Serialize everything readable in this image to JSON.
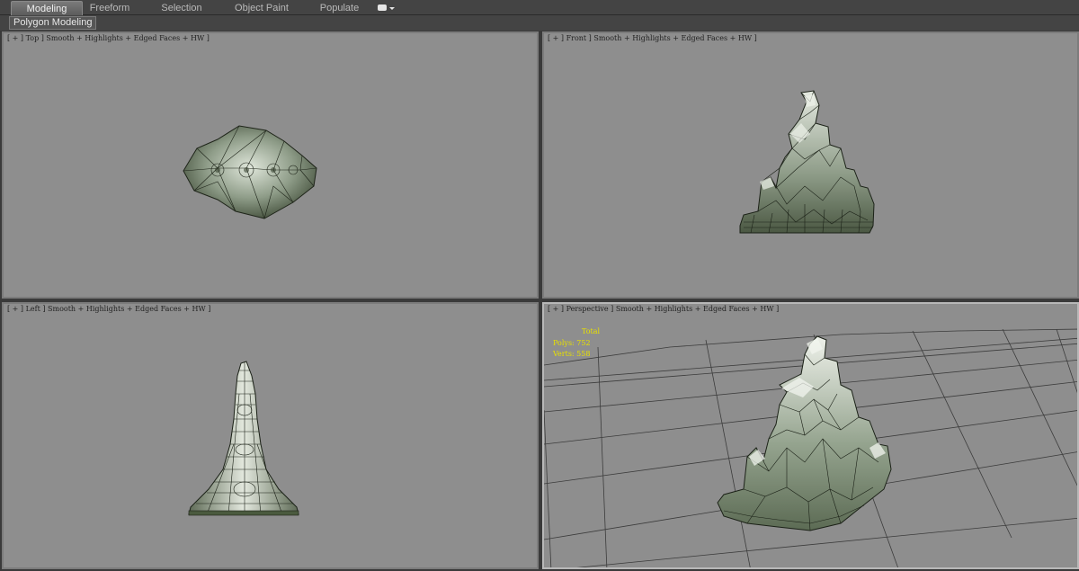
{
  "ribbon": {
    "tabs": [
      {
        "label": "Modeling",
        "active": true
      },
      {
        "label": "Freeform",
        "active": false
      },
      {
        "label": "Selection",
        "active": false
      },
      {
        "label": "Object Paint",
        "active": false
      },
      {
        "label": "Populate",
        "active": false
      }
    ],
    "extra_icon": "toggle-ribbon-icon",
    "panel_label": "Polygon Modeling"
  },
  "viewports": {
    "top": {
      "label": "[ + ] Top ] Smooth + Highlights + Edged Faces + HW ]"
    },
    "front": {
      "label": "[ + ] Front ] Smooth + Highlights + Edged Faces + HW ]"
    },
    "left": {
      "label": "[ + ] Left ] Smooth + Highlights + Edged Faces + HW ]"
    },
    "perspective": {
      "label": "[ + ] Perspective ] Smooth + Highlights + Edged Faces + HW ]"
    }
  },
  "stats": {
    "header": "Total",
    "polys": "Polys: 752",
    "verts": "Verts: 558"
  },
  "colors": {
    "viewport_bg": "#8e8e8e",
    "mesh_fill": "#7f8f7c",
    "mesh_light": "#e8ece4",
    "mesh_dark": "#39442f",
    "stats_text": "#e8e000",
    "active_border": "#b8b8b8"
  }
}
